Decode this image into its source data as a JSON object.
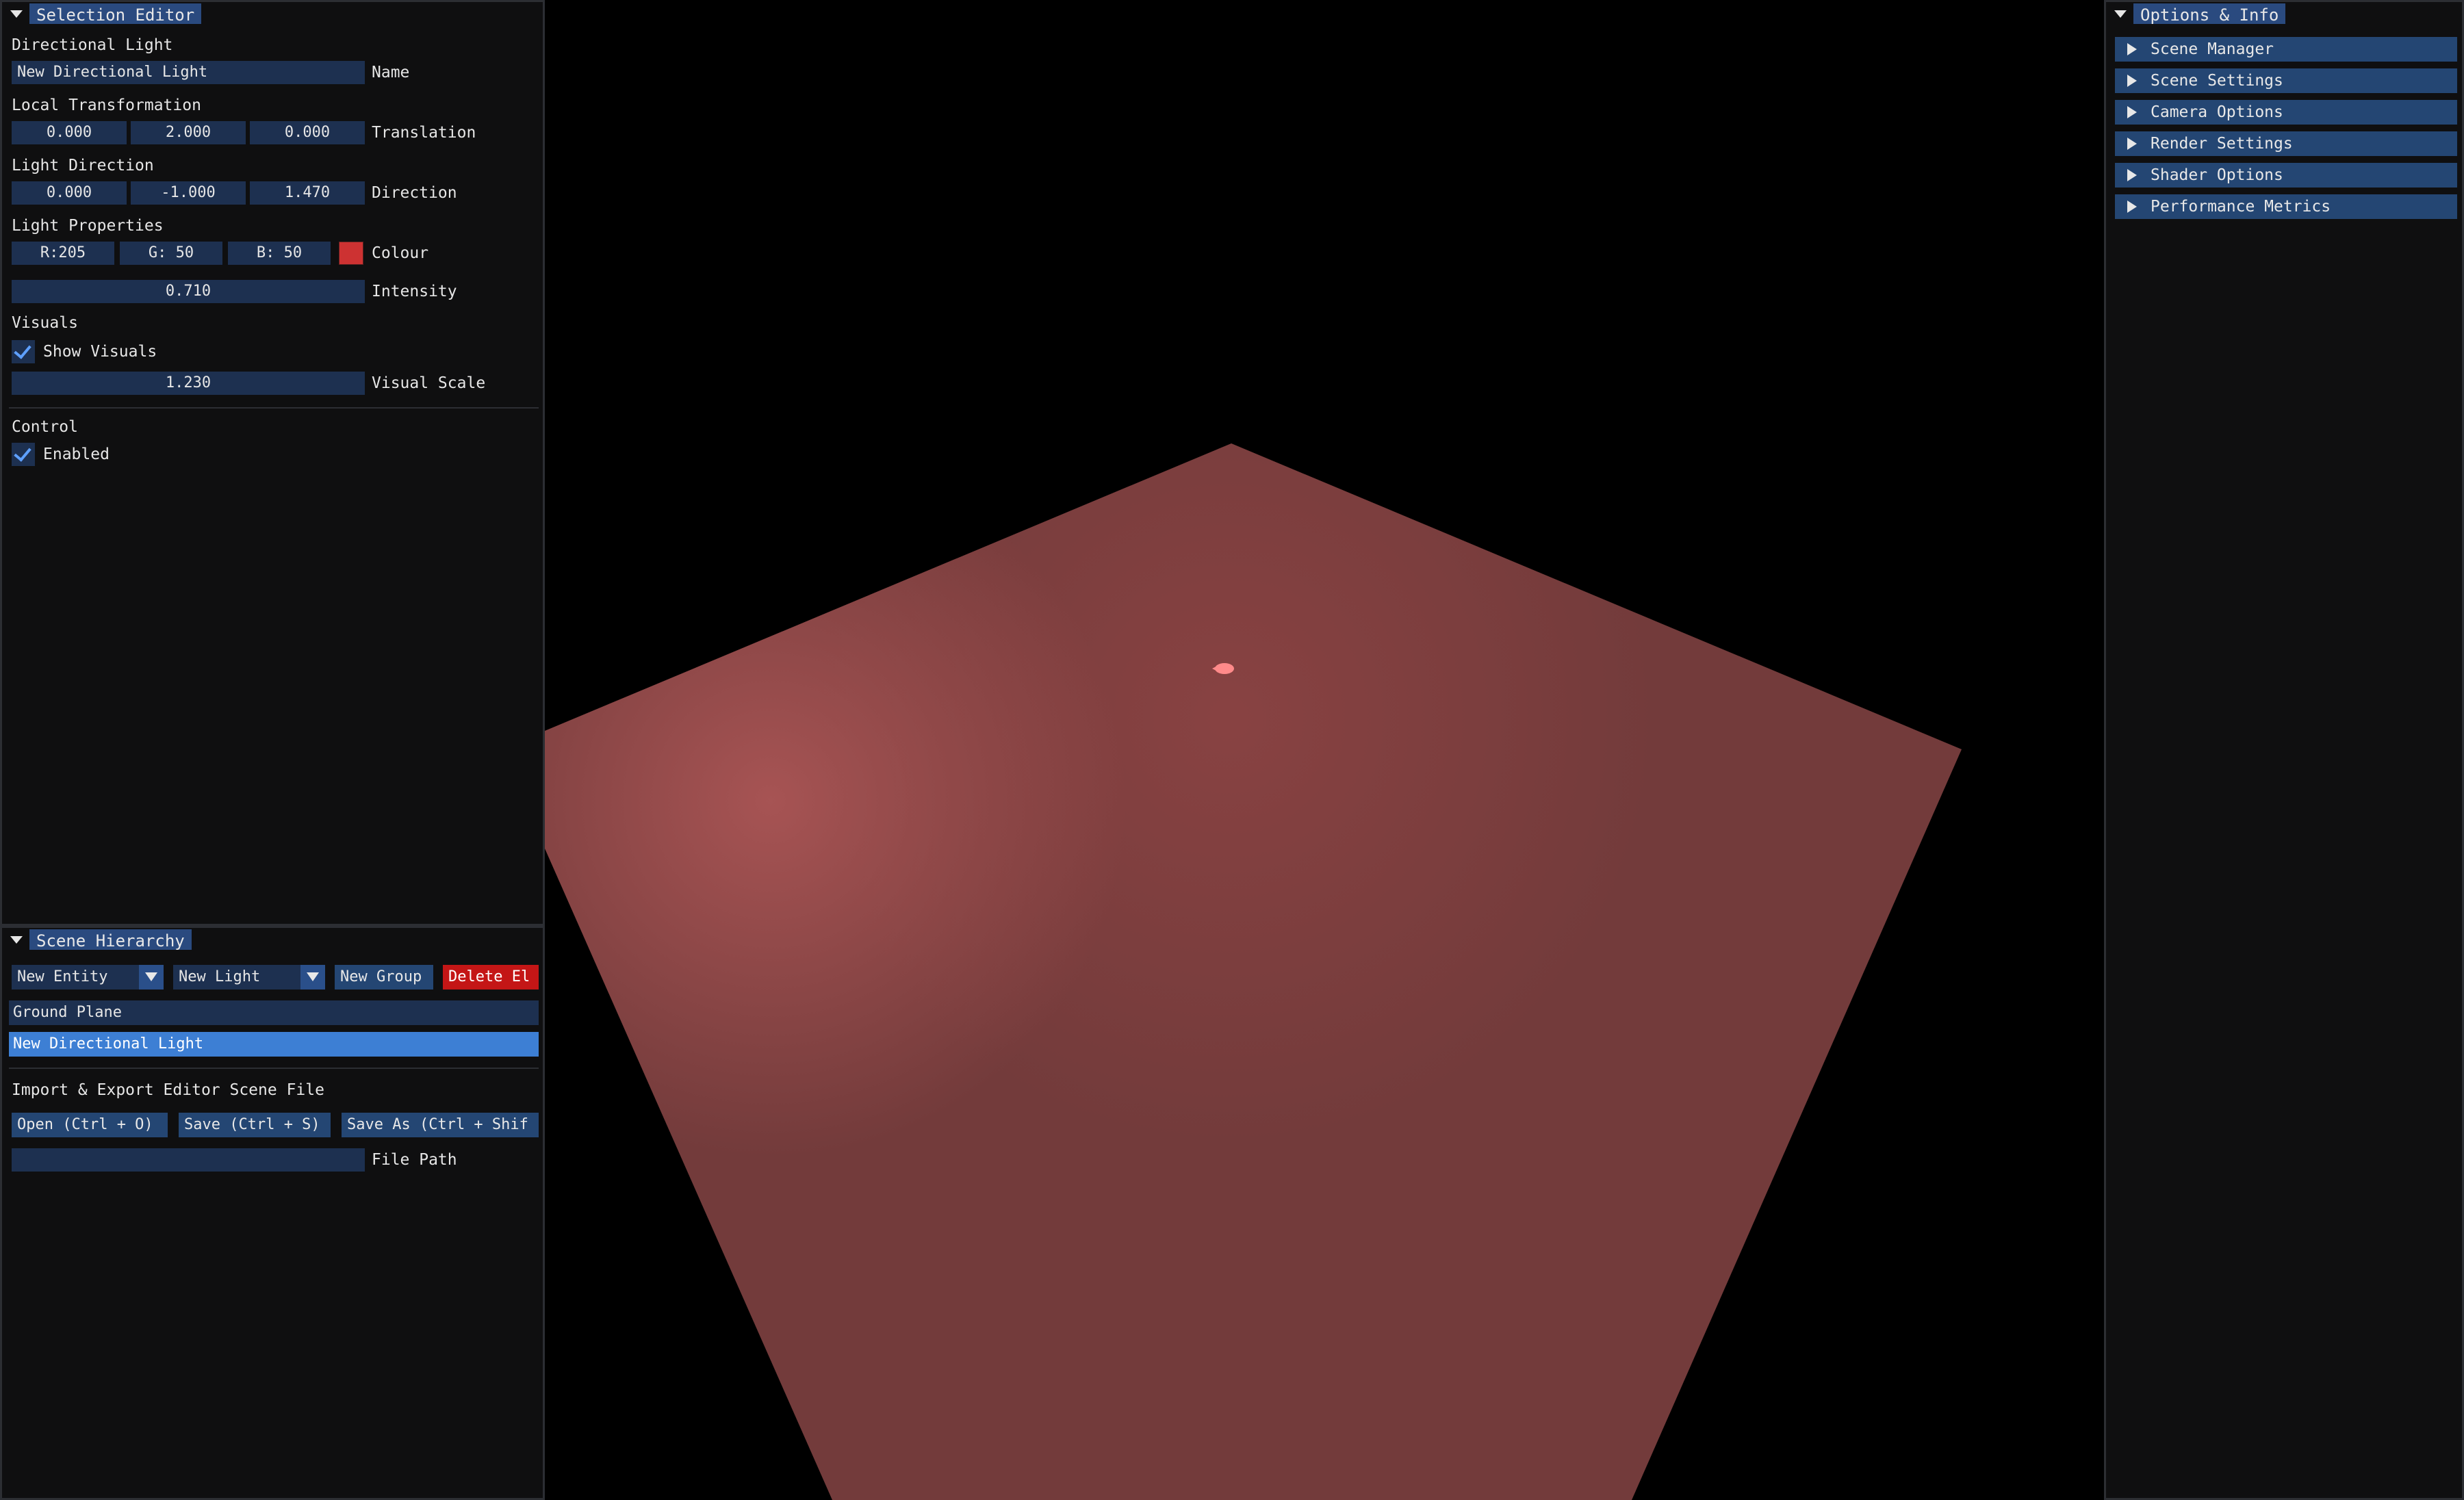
{
  "selection_editor": {
    "title": "Selection Editor",
    "object_type": "Directional Light",
    "name": {
      "value": "New Directional Light",
      "label": "Name"
    },
    "local_transformation": {
      "header": "Local Transformation",
      "values": [
        "0.000",
        "2.000",
        "0.000"
      ],
      "label": "Translation"
    },
    "light_direction": {
      "header": "Light Direction",
      "values": [
        "0.000",
        "-1.000",
        "1.470"
      ],
      "label": "Direction"
    },
    "light_properties": {
      "header": "Light Properties",
      "r": "R:205",
      "g": "G: 50",
      "b": "B: 50",
      "swatch_color": "#cd3232",
      "colour_label": "Colour",
      "intensity": "0.710",
      "intensity_label": "Intensity"
    },
    "visuals": {
      "header": "Visuals",
      "show_visuals_label": "Show Visuals",
      "show_visuals_checked": true,
      "scale": "1.230",
      "scale_label": "Visual Scale"
    },
    "control": {
      "header": "Control",
      "enabled_label": "Enabled",
      "enabled_checked": true
    }
  },
  "scene_hierarchy": {
    "title": "Scene Hierarchy",
    "new_entity": "New Entity",
    "new_light": "New Light",
    "new_group": "New Group",
    "delete": "Delete El",
    "items": [
      {
        "label": "Ground Plane",
        "selected": false
      },
      {
        "label": "New Directional Light",
        "selected": true
      }
    ],
    "import_export_header": "Import & Export Editor Scene File",
    "open_btn": "Open (Ctrl + O)",
    "save_btn": "Save (Ctrl + S)",
    "save_as_btn": "Save As (Ctrl + Shif",
    "file_path_value": "",
    "file_path_label": "File Path"
  },
  "options_info": {
    "title": "Options & Info",
    "sections": [
      "Scene Manager",
      "Scene Settings",
      "Camera Options",
      "Render Settings",
      "Shader Options",
      "Performance Metrics"
    ]
  },
  "viewport": {
    "background_color": "#000000",
    "plane_color": "#733b3b",
    "highlight_color": "#b05858",
    "light_gizmo_color": "#ff8a8a"
  }
}
